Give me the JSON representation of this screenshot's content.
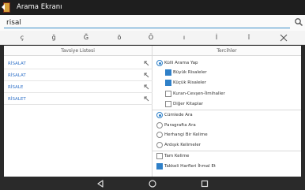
{
  "colors": {
    "accent": "#2f80c8",
    "link": "#3273c9",
    "statusbar": "#1e1e1e"
  },
  "app": {
    "title": "Arama Ekranı",
    "icon": "book-app-icon"
  },
  "search": {
    "value": "risal",
    "placeholder": "",
    "button_icon": "search-icon"
  },
  "charbar": {
    "keys": [
      "ç",
      "ğ",
      "Ğ",
      "ö",
      "Ö",
      "ı",
      "İ",
      "î",
      "Î"
    ],
    "close_icon": "close-icon"
  },
  "suggestions": {
    "header": "Tavsiye Listesi",
    "items": [
      {
        "label": "RİSALAT"
      },
      {
        "label": "RİSALAT"
      },
      {
        "label": "RİSALE"
      },
      {
        "label": "RİSALET"
      }
    ]
  },
  "preferences": {
    "header": "Tercihler",
    "kulli": {
      "label": "Külli Arama Yap",
      "selected": true
    },
    "books": [
      {
        "label": "Büyük Risaleler",
        "checked": true
      },
      {
        "label": "Küçük Risaleler",
        "checked": true
      },
      {
        "label": "Kuran-Cevşen-İlmihaller",
        "checked": false
      },
      {
        "label": "Diğer Kitaplar",
        "checked": false
      }
    ],
    "modes": [
      {
        "label": "Cümlede Ara",
        "selected": true
      },
      {
        "label": "Paragrafta Ara",
        "selected": false
      },
      {
        "label": "Herhangi Bir Kelime",
        "selected": false
      },
      {
        "label": "Ardışık Kelimeler",
        "selected": false
      }
    ],
    "extra": [
      {
        "label": "Tam Kelime",
        "checked": false
      },
      {
        "label": "Takkeli Harfleri İhmal Et",
        "checked": true
      }
    ]
  },
  "navbar": {
    "back_icon": "back-icon",
    "home_icon": "home-icon",
    "recents_icon": "recents-icon"
  }
}
